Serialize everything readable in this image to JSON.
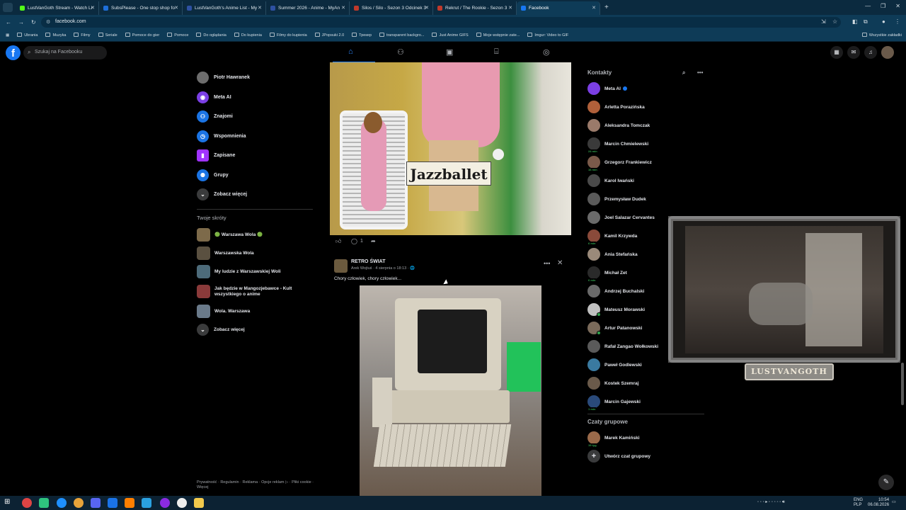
{
  "browser": {
    "tabs": [
      {
        "title": "LustVanGoth Stream - Watch Li",
        "color": "#53fc18"
      },
      {
        "title": "SubsPlease - One stop shop fo",
        "color": "#1e6fd9"
      },
      {
        "title": "LustVanGoth's Anime List - My",
        "color": "#2e51a2"
      },
      {
        "title": "Summer 2026 - Anime - MyAn",
        "color": "#2e51a2"
      },
      {
        "title": "Silos / Silo - Sezon 3 Odcinek 3",
        "color": "#c0392b"
      },
      {
        "title": "Rekrut / The Rookie - Sezon 3",
        "color": "#c0392b"
      },
      {
        "title": "Facebook",
        "color": "#1877f2",
        "active": true
      }
    ],
    "new_tab": "+",
    "url": "facebook.com",
    "bookmarks": [
      "Ubrania",
      "Muzyka",
      "Filmy",
      "Seriale",
      "Pomoce do gier",
      "Pomoce",
      "Do oglądania",
      "Do kupienia",
      "Filmy do kupienia",
      "JPopsuki 2.0",
      "Трекер",
      "transparent backgro...",
      "Just Anime GIFS",
      "Moje wstępnie zate...",
      "Imgur: Video to GIF"
    ],
    "all_bookmarks": "Wszystkie zakładki"
  },
  "facebook": {
    "logo": "f",
    "search_placeholder": "Szukaj na Facebooku",
    "left_menu": [
      {
        "label": "Piotr Hawranek",
        "icon": "avatar",
        "color": "#6d6d6d"
      },
      {
        "label": "Meta AI",
        "icon": "meta-ai-icon",
        "color": "#7b3fe4"
      },
      {
        "label": "Znajomi",
        "icon": "friends-icon",
        "color": "#1b74e4"
      },
      {
        "label": "Wspomnienia",
        "icon": "memories-icon",
        "color": "#1b74e4"
      },
      {
        "label": "Zapisane",
        "icon": "saved-icon",
        "color": "#a033ff"
      },
      {
        "label": "Grupy",
        "icon": "groups-icon",
        "color": "#1b74e4"
      },
      {
        "label": "Zobacz więcej",
        "icon": "chevron-down-icon",
        "color": "#3a3b3c"
      }
    ],
    "shortcuts_title": "Twoje skróty",
    "shortcuts": [
      {
        "label": "🟢 Warszawa Wola 🟢",
        "color": "#7d6a4a"
      },
      {
        "label": "Warszawska Wola",
        "color": "#5a5040"
      },
      {
        "label": "My ludzie z Warszawskiej Woli",
        "color": "#4d6b7a"
      },
      {
        "label": "Jak będzie w Mangozjebawce - Kult wszystkiego o anime",
        "color": "#8a3a3a"
      },
      {
        "label": "Wola. Warszawa",
        "color": "#6a7a8a"
      },
      {
        "label": "Zobacz więcej",
        "color": "#3a3b3c"
      }
    ],
    "footer": "Prywatność · Regulamin · Reklama · Opcje reklam ▷ · Pliki cookie · Więcej",
    "post1": {
      "image_text": "Jazzballet",
      "comment_count": "1"
    },
    "post2": {
      "author": "RETRO ŚWIAT",
      "meta": "Arek Wojtuś · 4 sierpnia o 18:13 · 🌐",
      "text": "Chory człowiek, chory człowiek..."
    },
    "contacts_title": "Kontakty",
    "contacts": [
      {
        "name": "Meta AI",
        "color": "#7b3fe4",
        "online": false,
        "verified": true
      },
      {
        "name": "Arletta Porazińska",
        "color": "#b0603a",
        "online": false
      },
      {
        "name": "Aleksandra Tomczak",
        "color": "#9a7a6a",
        "online": false
      },
      {
        "name": "Marcin Chmielewski",
        "color": "#3a3a3a",
        "online": false,
        "mins": "24 min"
      },
      {
        "name": "Grzegorz Frankiewicz",
        "color": "#7a5a4a",
        "online": false,
        "mins": "16 min"
      },
      {
        "name": "Karol Iwański",
        "color": "#4a4a4a",
        "online": false
      },
      {
        "name": "Przemysław Dudek",
        "color": "#5a5a5a",
        "online": false
      },
      {
        "name": "Joel Salazar Cervantes",
        "color": "#6a6a6a",
        "online": false
      },
      {
        "name": "Kamil Krzywda",
        "color": "#8a4a3a",
        "online": false,
        "mins": "6 min"
      },
      {
        "name": "Ania Stefańska",
        "color": "#9a8a7a",
        "online": false
      },
      {
        "name": "Michał Zet",
        "color": "#2a2a2a",
        "online": false,
        "mins": "6 min"
      },
      {
        "name": "Andrzej Buchalski",
        "color": "#6a6a6a",
        "online": false
      },
      {
        "name": "Mateusz Morawski",
        "color": "#c0c0c0",
        "online": true
      },
      {
        "name": "Artur Patanowski",
        "color": "#7a6a5a",
        "online": true
      },
      {
        "name": "Rafał Zangao Wołkowski",
        "color": "#5a5a5a",
        "online": false
      },
      {
        "name": "Paweł Godlewski",
        "color": "#3a7aa0",
        "online": false
      },
      {
        "name": "Kostek Szemraj",
        "color": "#6a5a4a",
        "online": false
      },
      {
        "name": "Marcin Gajewski",
        "color": "#2a4a7a",
        "online": false,
        "mins": "1 min"
      }
    ],
    "group_chats_title": "Czaty grupowe",
    "group_chats": [
      {
        "name": "Marek Kamiński",
        "color": "#9a6a4a",
        "mins": "19 tyg."
      },
      {
        "name": "Utwórz czat grupowy",
        "color": "#3a3b3c",
        "icon": "plus-icon"
      }
    ]
  },
  "overlay": {
    "watermark": "LUSTVANGOTH"
  },
  "taskbar": {
    "lang": "ENG",
    "layout": "PLP",
    "time": "10:54",
    "date": "06.08.2026"
  }
}
